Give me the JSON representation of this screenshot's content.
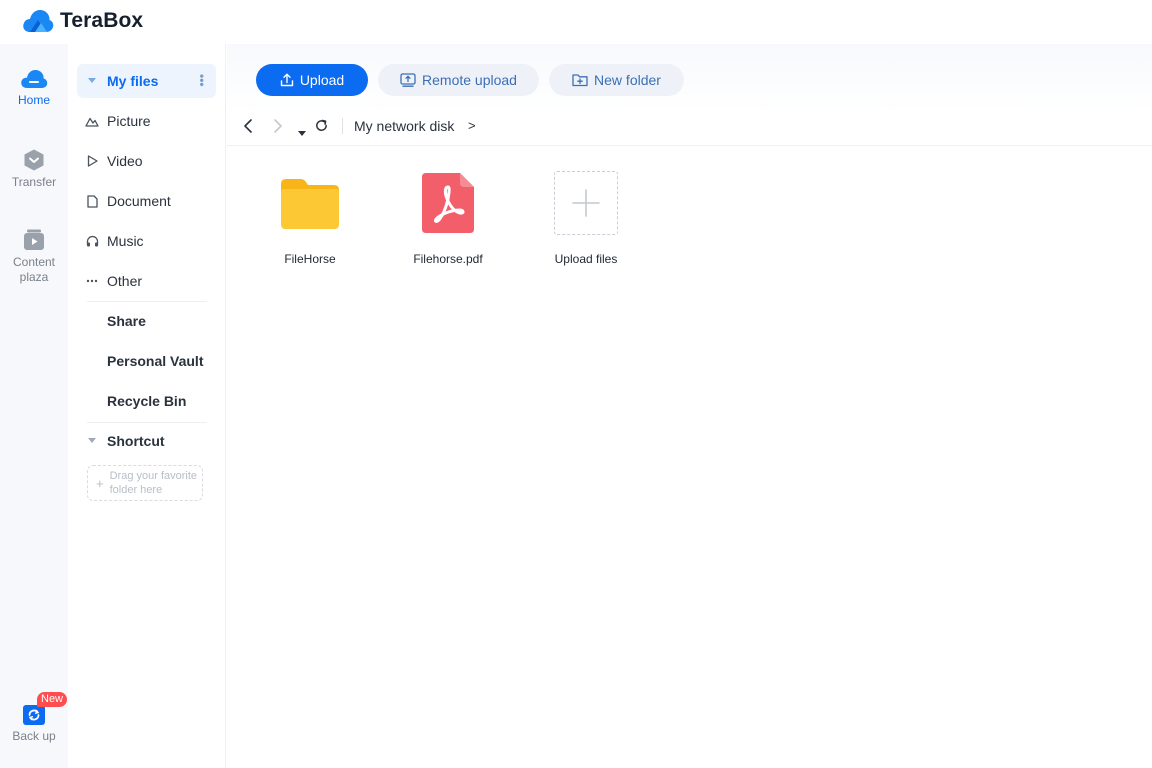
{
  "app": {
    "name": "TeraBox"
  },
  "rail": {
    "home": "Home",
    "transfer": "Transfer",
    "content_plaza": "Content plaza",
    "backup": "Back up",
    "new_badge": "New"
  },
  "nav": {
    "my_files": "My files",
    "picture": "Picture",
    "video": "Video",
    "document": "Document",
    "music": "Music",
    "other": "Other",
    "share": "Share",
    "personal_vault": "Personal Vault",
    "recycle_bin": "Recycle Bin",
    "shortcut": "Shortcut",
    "shortcut_drop": "Drag your favorite folder here"
  },
  "toolbar": {
    "upload": "Upload",
    "remote_upload": "Remote upload",
    "new_folder": "New folder"
  },
  "path": {
    "root": "My network disk",
    "arrow": ">"
  },
  "files": [
    {
      "name": "FileHorse",
      "kind": "folder-icon"
    },
    {
      "name": "Filehorse.pdf",
      "kind": "pdf-icon"
    },
    {
      "name": "Upload files",
      "kind": "add-icon"
    }
  ],
  "colors": {
    "accent": "#0b6bf1",
    "folder": "#fcc935",
    "pdf": "#f25f6a",
    "badge": "#ff4d4f"
  }
}
